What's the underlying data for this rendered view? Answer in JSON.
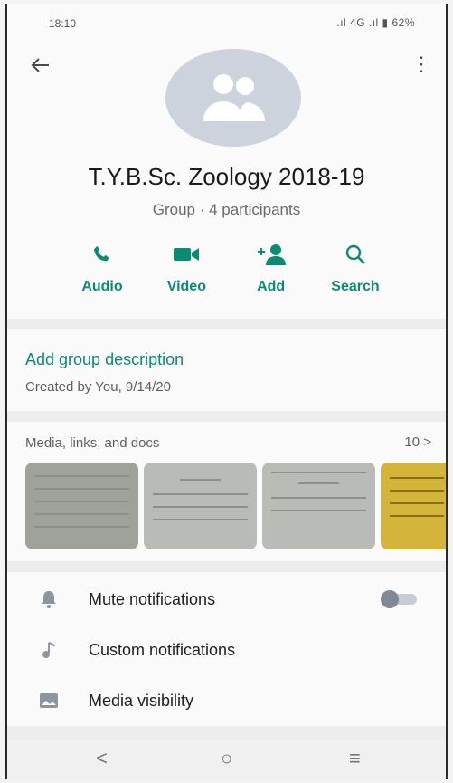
{
  "status_bar": {
    "time": "18:10",
    "right": ".ıl 4G .ıl ▮ 62%"
  },
  "header": {
    "back_icon": "arrow-left-icon",
    "menu_icon": "more-vert-icon"
  },
  "group": {
    "name": "T.Y.B.Sc. Zoology 2018-19",
    "subtitle": "Group · 4 participants"
  },
  "actions": [
    {
      "label": "Audio",
      "icon": "phone-icon"
    },
    {
      "label": "Video",
      "icon": "video-icon"
    },
    {
      "label": "Add",
      "icon": "add-person-icon"
    },
    {
      "label": "Search",
      "icon": "search-icon"
    }
  ],
  "description": {
    "add_label": "Add group description",
    "created": "Created by You, 9/14/20"
  },
  "media": {
    "title": "Media, links, and docs",
    "count": "10 >"
  },
  "menu": [
    {
      "label": "Mute notifications",
      "icon": "bell-icon",
      "toggle": false
    },
    {
      "label": "Custom notifications",
      "icon": "music-note-icon"
    },
    {
      "label": "Media visibility",
      "icon": "image-icon"
    }
  ],
  "colors": {
    "accent": "#0b8b72",
    "avatar_bg": "#ccd3dc"
  },
  "navbar": {
    "back": "<",
    "home": "○",
    "recents": "≡"
  }
}
